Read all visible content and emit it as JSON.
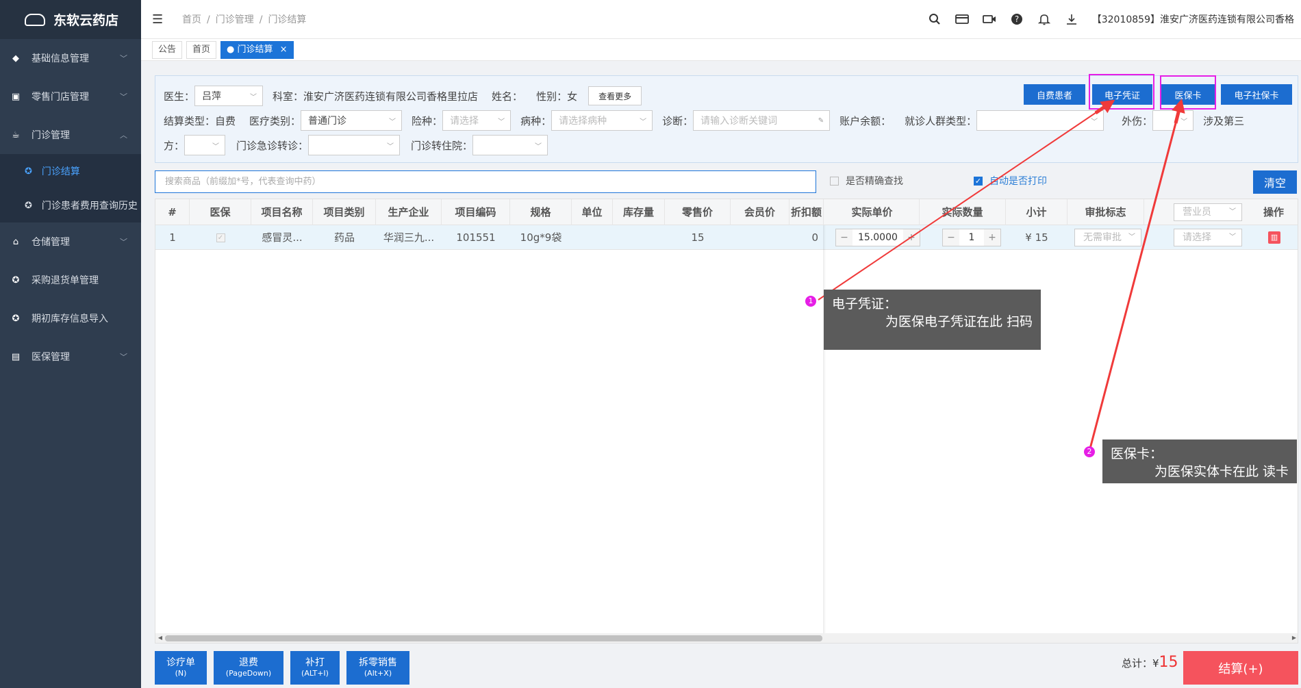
{
  "app": {
    "name": "东软云药店"
  },
  "sidebar": {
    "items": [
      {
        "label": "基础信息管理"
      },
      {
        "label": "零售门店管理"
      },
      {
        "label": "门诊管理"
      },
      {
        "label": "仓储管理"
      },
      {
        "label": "采购退货单管理"
      },
      {
        "label": "期初库存信息导入"
      },
      {
        "label": "医保管理"
      }
    ],
    "sub_items": [
      {
        "label": "门诊结算"
      },
      {
        "label": "门诊患者费用查询历史"
      }
    ]
  },
  "breadcrumb": {
    "home": "首页",
    "sep": "/",
    "level1": "门诊管理",
    "level2": "门诊结算"
  },
  "header": {
    "org": "【32010859】淮安广济医药连锁有限公司香格"
  },
  "tabs": {
    "t1": "公告",
    "t2": "首页",
    "t3": "门诊结算",
    "close": "×"
  },
  "form": {
    "doctor_label": "医生：",
    "doctor_value": "吕萍",
    "dept_label": "科室：",
    "dept_value": "淮安广济医药连锁有限公司香格里拉店",
    "name_label": "姓名：",
    "gender_label": "性别：",
    "gender_value": "女",
    "more_button": "查看更多",
    "self_pay_button": "自费患者",
    "e_voucher_button": "电子凭证",
    "insurance_card_button": "医保卡",
    "e_social_card_button": "电子社保卡",
    "settle_type_label": "结算类型：",
    "settle_type_value": "自费",
    "med_type_label": "医疗类别：",
    "med_type_value": "普通门诊",
    "insurance_type_label": "险种：",
    "insurance_type_placeholder": "请选择",
    "disease_label": "病种：",
    "disease_placeholder": "请选择病种",
    "diagnosis_label": "诊断：",
    "diagnosis_placeholder": "请输入诊断关键词",
    "balance_label": "账户余额：",
    "crowd_type_label": "就诊人群类型：",
    "injury_label": "外伤：",
    "third_party_label_a": "涉及第三",
    "third_party_label_b": "方：",
    "emergency_label": "门诊急诊转诊：",
    "hospitalize_label": "门诊转住院："
  },
  "search": {
    "placeholder": "搜索商品（前缀加*号，代表查询中药）",
    "exact_label": "是否精确查找",
    "auto_print_label": "自动是否打印",
    "clear_button": "清空"
  },
  "table": {
    "headers": [
      "#",
      "医保",
      "项目名称",
      "项目类别",
      "生产企业",
      "项目编码",
      "规格",
      "单位",
      "库存量",
      "零售价",
      "会员价",
      "折扣额",
      "实际单价",
      "实际数量",
      "小计",
      "审批标志",
      "营业员",
      "操作"
    ],
    "row": {
      "index": "1",
      "check": "✓",
      "name": "感冒灵...",
      "category": "药品",
      "maker": "华润三九...",
      "code": "101551",
      "spec": "10g*9袋",
      "unit": "",
      "stock": "",
      "retail": "15",
      "member": "",
      "discount": "0",
      "unit_price": "15.0000",
      "qty": "1",
      "subtotal": "¥ 15",
      "approval_placeholder": "无需审批",
      "clerk_placeholder": "请选择"
    }
  },
  "stepper": {
    "minus": "−",
    "plus": "+"
  },
  "bottom": {
    "b1_label": "诊疗单",
    "b1_key": "(N)",
    "b2_label": "退费",
    "b2_key": "(PageDown)",
    "b3_label": "补打",
    "b3_key": "(ALT+I)",
    "b4_label": "拆零销售",
    "b4_key": "(Alt+X)",
    "total_label": "总计：¥",
    "total_value": "15",
    "settle_button": "结算(+)"
  },
  "tooltips": {
    "t1_num": "1",
    "t1_title": "电子凭证：",
    "t1_body": "为医保电子凭证在此 扫码",
    "t2_num": "2",
    "t2_title": "医保卡：",
    "t2_body": "为医保实体卡在此 读卡"
  },
  "colors": {
    "accent": "#1c6dd0",
    "sidebar": "#2f3d4f",
    "highlight": "#e61ee6",
    "arrow": "#f03a3a",
    "danger": "#f5535d"
  }
}
